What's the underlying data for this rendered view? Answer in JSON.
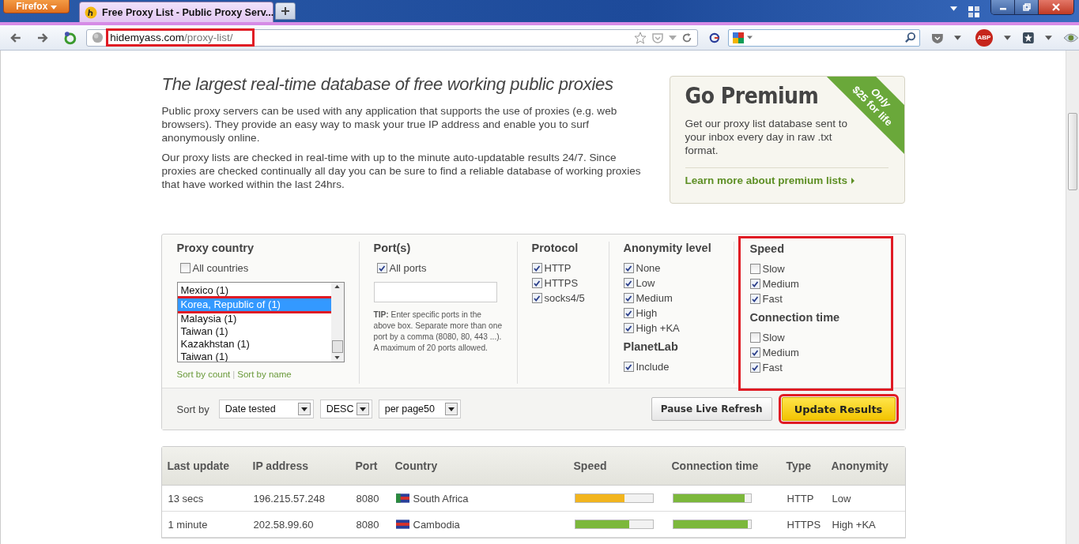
{
  "browser": {
    "menu_button": "Firefox",
    "tab": {
      "title": "Free Proxy List - Public Proxy Serv...",
      "selected": true
    },
    "url": {
      "host": "hidemyass.com",
      "path": "/proxy-list/",
      "annotated": true
    },
    "addon_badge": "ABP"
  },
  "intro": {
    "heading": "The largest real-time database of free working public proxies",
    "paragraphs": [
      "Public proxy servers can be used with any application that supports the use of proxies (e.g. web browsers). They provide an easy way to mask your true IP address and enable you to surf anonymously online.",
      "Our proxy lists are checked in real-time with up to the minute auto-updatable results 24/7. Since proxies are checked continually all day you can be sure to find a reliable database of working proxies that have worked within the last 24hrs."
    ]
  },
  "premium": {
    "title": "Go Premium",
    "ribbon": [
      "Only",
      "$25 for life"
    ],
    "text": "Get our proxy list database sent to your inbox every day in raw .txt format.",
    "link": "Learn more about premium lists"
  },
  "filters": {
    "country": {
      "title": "Proxy country",
      "all": {
        "label": "All countries",
        "checked": false
      },
      "list": [
        {
          "label": "Mexico (1)",
          "selected": false,
          "annotated": false
        },
        {
          "label": "Korea, Republic of (1)",
          "selected": true,
          "annotated": true
        },
        {
          "label": "Malaysia (1)",
          "selected": false,
          "annotated": false
        },
        {
          "label": "Taiwan (1)",
          "selected": false,
          "annotated": false
        },
        {
          "label": "Kazakhstan (1)",
          "selected": false,
          "annotated": false
        },
        {
          "label": "Taiwan (1)",
          "selected": false,
          "annotated": false
        }
      ],
      "sort_links": [
        "Sort by count",
        "Sort by name"
      ],
      "sort_separator": "|"
    },
    "ports": {
      "title": "Port(s)",
      "all": {
        "label": "All ports",
        "checked": true
      },
      "tip": "**TIP:** Enter specific ports in the above box. Separate more than one port by a comma (8080, 80, 443 ...). A maximum of 20 ports allowed."
    },
    "protocol": {
      "title": "Protocol",
      "options": [
        {
          "label": "HTTP",
          "checked": true
        },
        {
          "label": "HTTPS",
          "checked": true
        },
        {
          "label": "socks4/5",
          "checked": true
        }
      ]
    },
    "anonymity": {
      "title": "Anonymity level",
      "options": [
        {
          "label": "None",
          "checked": true
        },
        {
          "label": "Low",
          "checked": true
        },
        {
          "label": "Medium",
          "checked": true
        },
        {
          "label": "High",
          "checked": true
        },
        {
          "label": "High +KA",
          "checked": true
        }
      ]
    },
    "planetlab": {
      "title": "PlanetLab",
      "options": [
        {
          "label": "Include",
          "checked": true
        }
      ]
    },
    "timing": {
      "annotated": true,
      "speed": {
        "title": "Speed",
        "options": [
          {
            "label": "Slow",
            "checked": false
          },
          {
            "label": "Medium",
            "checked": true
          },
          {
            "label": "Fast",
            "checked": true
          }
        ]
      },
      "connection_time": {
        "title": "Connection time",
        "options": [
          {
            "label": "Slow",
            "checked": false
          },
          {
            "label": "Medium",
            "checked": true
          },
          {
            "label": "Fast",
            "checked": true
          }
        ]
      }
    },
    "sort_label": "Sort by",
    "selects": [
      {
        "value": "Date tested"
      },
      {
        "value": "DESC"
      },
      {
        "value": "per page50"
      }
    ],
    "buttons": [
      {
        "label": "Pause Live Refresh",
        "kind": "secondary",
        "annotated": false
      },
      {
        "label": "Update Results",
        "kind": "primary",
        "annotated": true
      }
    ]
  },
  "table": {
    "columns": [
      "Last update",
      "IP address",
      "Port",
      "Country",
      "Speed",
      "Connection time",
      "Type",
      "Anonymity"
    ],
    "rows": [
      {
        "last_update": "13 secs",
        "ip": "196.215.57.248",
        "port": "8080",
        "country": "South Africa",
        "speed": {
          "level": 0.64,
          "color": "#f2b51e"
        },
        "connection_time": {
          "level": 0.92,
          "color": "#7cb83c"
        },
        "type": "HTTP",
        "anonymity": "Low"
      },
      {
        "last_update": "1 minute",
        "ip": "202.58.99.60",
        "port": "8080",
        "country": "Cambodia",
        "speed": {
          "level": 0.7,
          "color": "#7cb83c"
        },
        "connection_time": {
          "level": 0.96,
          "color": "#7cb83c"
        },
        "type": "HTTPS",
        "anonymity": "High +KA"
      }
    ]
  }
}
